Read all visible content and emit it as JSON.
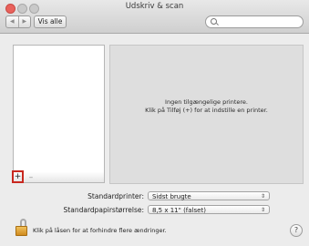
{
  "window": {
    "title": "Udskriv & scan"
  },
  "toolbar": {
    "back_glyph": "◀",
    "forward_glyph": "▶",
    "show_all_label": "Vis alle",
    "search_placeholder": "",
    "search_value": ""
  },
  "printer_list": {
    "add_label": "+",
    "remove_label": "–"
  },
  "detail": {
    "message_line1": "Ingen tilgængelige printere.",
    "message_line2": "Klik på Tilføj (+) for at indstille en printer."
  },
  "settings": {
    "default_printer_label": "Standardprinter:",
    "default_printer_value": "Sidst brugte",
    "default_paper_label": "Standardpapirstørrelse:",
    "default_paper_value": "8,5 x 11\" (falset)",
    "popup_arrows": "⇕"
  },
  "footer": {
    "lock_text": "Klik på låsen for at forhindre flere ændringer.",
    "help_label": "?"
  },
  "colors": {
    "add_highlight": "#c8281f",
    "close_button": "#e9625c",
    "lock_gold": "#f0c15c"
  }
}
